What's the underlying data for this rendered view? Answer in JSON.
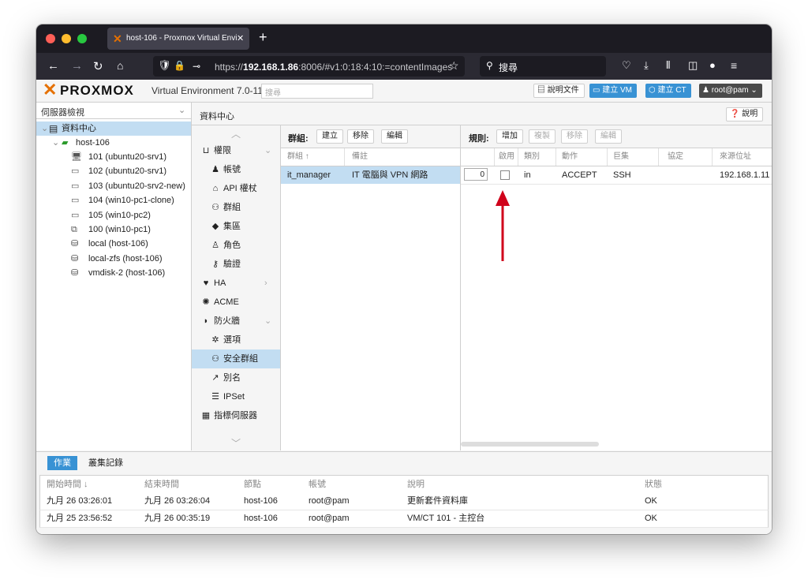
{
  "browser": {
    "tab_title": "host-106 - Proxmox Virtual Envi",
    "url_prefix": "https://",
    "url_host": "192.168.1.86",
    "url_rest": ":8006/#v1:0:18:4:10:=contentImages",
    "search_placeholder": "搜尋"
  },
  "header": {
    "logo": "PROXMOX",
    "product": "Virtual Environment 7.0-11",
    "search_placeholder": "搜尋",
    "docs": "說明文件",
    "create_vm": "建立 VM",
    "create_ct": "建立 CT",
    "user": "root@pam"
  },
  "tree": {
    "view": "伺服器檢視",
    "datacenter": "資料中心",
    "node": "host-106",
    "items": [
      {
        "label": "101 (ubuntu20-srv1)"
      },
      {
        "label": "102 (ubuntu20-srv1)"
      },
      {
        "label": "103 (ubuntu20-srv2-new)"
      },
      {
        "label": "104 (win10-pc1-clone)"
      },
      {
        "label": "105 (win10-pc2)"
      },
      {
        "label": "100 (win10-pc1)"
      },
      {
        "label": "local (host-106)"
      },
      {
        "label": "local-zfs (host-106)"
      },
      {
        "label": "vmdisk-2 (host-106)"
      }
    ]
  },
  "content": {
    "title": "資料中心",
    "help": "說明"
  },
  "menu": {
    "items": [
      {
        "label": "權限"
      },
      {
        "label": "帳號"
      },
      {
        "label": "API 權杖"
      },
      {
        "label": "群組"
      },
      {
        "label": "集區"
      },
      {
        "label": "角色"
      },
      {
        "label": "驗證"
      },
      {
        "label": "HA"
      },
      {
        "label": "ACME"
      },
      {
        "label": "防火牆"
      },
      {
        "label": "選項"
      },
      {
        "label": "安全群組"
      },
      {
        "label": "別名"
      },
      {
        "label": "IPSet"
      },
      {
        "label": "指標伺服器"
      }
    ]
  },
  "groups": {
    "label": "群組:",
    "create": "建立",
    "remove": "移除",
    "edit": "編輯",
    "col_group": "群組 ↑",
    "col_comment": "備註",
    "rows": [
      {
        "group": "it_manager",
        "comment": "IT 電腦與 VPN 網路"
      }
    ]
  },
  "rules": {
    "label": "規則:",
    "add": "增加",
    "copy": "複製",
    "remove": "移除",
    "edit": "編輯",
    "columns": [
      "啟用",
      "類別",
      "動作",
      "巨集",
      "協定",
      "來源位址"
    ],
    "rows": [
      {
        "num": "0",
        "enabled": false,
        "type": "in",
        "action": "ACCEPT",
        "macro": "SSH",
        "protocol": "",
        "source": "192.168.1.11"
      }
    ]
  },
  "log": {
    "tab_tasks": "作業",
    "tab_cluster": "叢集記錄",
    "columns": [
      "開始時間 ↓",
      "結束時間",
      "節點",
      "帳號",
      "說明",
      "狀態"
    ],
    "rows": [
      {
        "start": "九月 26 03:26:01",
        "end": "九月 26 03:26:04",
        "node": "host-106",
        "user": "root@pam",
        "desc": "更新套件資料庫",
        "status": "OK"
      },
      {
        "start": "九月 25 23:56:52",
        "end": "九月 26 00:35:19",
        "node": "host-106",
        "user": "root@pam",
        "desc": "VM/CT 101 - 主控台",
        "status": "OK"
      }
    ]
  },
  "colors": {
    "accent": "#3892d4",
    "arrow": "#d0021b",
    "selection": "#c2ddf2",
    "brand_orange": "#e57000"
  }
}
